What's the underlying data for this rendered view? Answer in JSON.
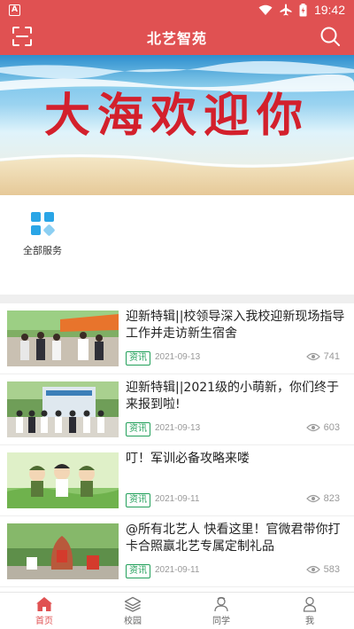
{
  "status_bar": {
    "time": "19:42",
    "app_badge": "A"
  },
  "header": {
    "title": "北艺智苑"
  },
  "banner": {
    "text": "大海欢迎你"
  },
  "services": [
    {
      "label": "全部服务",
      "icon": "grid-icon"
    }
  ],
  "news": [
    {
      "title": "迎新特辑||校领导深入我校迎新现场指导工作并走访新生宿舍",
      "tag": "资讯",
      "date": "2021-09-13",
      "views": "741"
    },
    {
      "title": "迎新特辑||2021级的小萌新，你们终于来报到啦!",
      "tag": "资讯",
      "date": "2021-09-13",
      "views": "603"
    },
    {
      "title": "叮！军训必备攻略来喽",
      "tag": "资讯",
      "date": "2021-09-11",
      "views": "823"
    },
    {
      "title": "@所有北艺人 快看这里！官微君带你打卡合照赢北艺专属定制礼品",
      "tag": "资讯",
      "date": "2021-09-11",
      "views": "583"
    }
  ],
  "bottom_nav": [
    {
      "label": "首页",
      "icon": "home-icon",
      "active": true
    },
    {
      "label": "校园",
      "icon": "layers-icon",
      "active": false
    },
    {
      "label": "同学",
      "icon": "classmates-icon",
      "active": false
    },
    {
      "label": "我",
      "icon": "person-icon",
      "active": false
    }
  ],
  "colors": {
    "brand": "#e05152",
    "tag_green": "#22a05a",
    "service_icon": "#2aa5e6"
  }
}
